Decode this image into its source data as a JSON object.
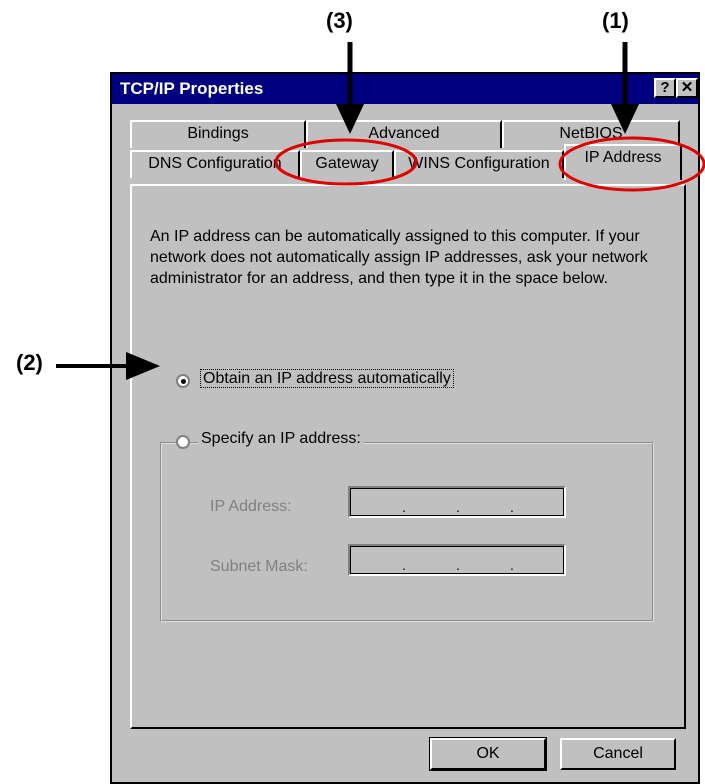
{
  "callouts": {
    "one": "(1)",
    "two": "(2)",
    "three": "(3)"
  },
  "window": {
    "title": "TCP/IP Properties",
    "help_label": "?",
    "close_label": "✕"
  },
  "tabs": {
    "back_row": [
      "Bindings",
      "Advanced",
      "NetBIOS"
    ],
    "front_row": [
      "DNS Configuration",
      "Gateway",
      "WINS Configuration",
      "IP Address"
    ]
  },
  "panel": {
    "description": "An IP address can be automatically assigned to this computer. If your network does not automatically assign IP addresses, ask your network administrator for an address, and then type it in the space below.",
    "option_auto": "Obtain an IP address automatically",
    "option_specify": "Specify an IP address:",
    "ip_address_label": "IP Address:",
    "subnet_mask_label": "Subnet Mask:",
    "selected_option": "auto"
  },
  "buttons": {
    "ok": "OK",
    "cancel": "Cancel"
  },
  "colors": {
    "titlebar": "#000080",
    "face": "#c0c0c0",
    "highlight": "#e00000"
  }
}
